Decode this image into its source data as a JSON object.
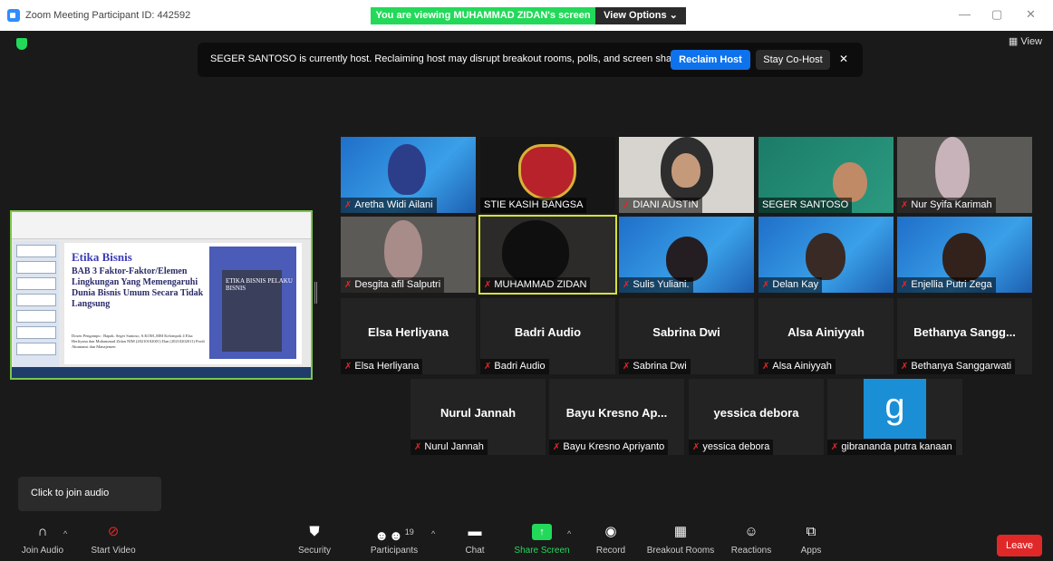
{
  "window": {
    "title": "Zoom Meeting Participant ID: 442592",
    "viewing_banner": "You are viewing MUHAMMAD ZIDAN's screen",
    "view_options": "View Options ⌄",
    "minimize": "—",
    "restore": "▢",
    "close": "✕"
  },
  "top": {
    "view_label": "▦ View"
  },
  "host_notice": {
    "message": "SEGER SANTOSO is currently host. Reclaiming host may disrupt breakout rooms, polls, and screen share",
    "reclaim_label": "Reclaim Host",
    "cohost_label": "Stay Co-Host",
    "close": "✕"
  },
  "shared_screen": {
    "slide_title": "Etika Bisnis",
    "slide_subtitle": "BAB 3 Faktor-Faktor/Elemen Lingkungan Yang Memengaruhi Dunia Bisnis Umum Secara Tidak Langsung",
    "slide_footer": "Dosen Pengampu : Bapak. Seger Santoso, S.KOM.,MM Kelompok 4 Elsa Herliyana dan Muhammad Zidan NIM (20210102001) Dan (20210202011) Prodi Akuntansi dan Manajemen",
    "book_title": "ETIKA BISNIS PELAKU BISNIS"
  },
  "participants": [
    {
      "name": "Aretha Widi Ailani",
      "big_name": "",
      "bg": "bg-blue"
    },
    {
      "name": "STIE KASIH BANGSA",
      "big_name": "",
      "bg": "bg-dark"
    },
    {
      "name": "DIANI AUSTIN",
      "big_name": "",
      "bg": "bg-wall"
    },
    {
      "name": "SEGER SANTOSO",
      "big_name": "",
      "bg": "bg-teal"
    },
    {
      "name": "Nur Syifa Karimah",
      "big_name": "",
      "bg": "bg-room"
    },
    {
      "name": "Desgita afil Salputri",
      "big_name": "",
      "bg": "bg-room"
    },
    {
      "name": "MUHAMMAD ZIDAN",
      "big_name": "",
      "bg": "bg-shadow"
    },
    {
      "name": "Sulis Yuliani.",
      "big_name": "",
      "bg": "bg-blue"
    },
    {
      "name": "Delan Kay",
      "big_name": "",
      "bg": "bg-blue"
    },
    {
      "name": "Enjellia Putri Zega",
      "big_name": "",
      "bg": "bg-blue"
    },
    {
      "name": "Elsa Herliyana",
      "big_name": "Elsa Herliyana",
      "bg": ""
    },
    {
      "name": "Badri Audio",
      "big_name": "Badri Audio",
      "bg": ""
    },
    {
      "name": "Sabrina Dwi",
      "big_name": "Sabrina Dwi",
      "bg": ""
    },
    {
      "name": "Alsa Ainiyyah",
      "big_name": "Alsa Ainiyyah",
      "bg": ""
    },
    {
      "name": "Bethanya Sanggarwati",
      "big_name": "Bethanya  Sangg...",
      "bg": ""
    },
    {
      "name": "Nurul Jannah",
      "big_name": "Nurul Jannah",
      "bg": ""
    },
    {
      "name": "Bayu Kresno Apriyanto",
      "big_name": "Bayu Kresno Ap...",
      "bg": ""
    },
    {
      "name": "yessica debora",
      "big_name": "yessica debora",
      "bg": ""
    },
    {
      "name": "gibrananda putra kanaan",
      "big_name": "",
      "bg": "",
      "avatar_letter": "g"
    }
  ],
  "tooltip": "Click to join audio",
  "toolbar": {
    "join_audio": "Join Audio",
    "start_video": "Start Video",
    "security": "Security",
    "participants": "Participants",
    "participant_count": "19",
    "chat": "Chat",
    "share_screen": "Share Screen",
    "record": "Record",
    "breakout_rooms": "Breakout Rooms",
    "reactions": "Reactions",
    "apps": "Apps",
    "leave": "Leave"
  },
  "colors": {
    "accent_green": "#23d959",
    "accent_blue": "#0e72ed",
    "leave_red": "#e02828",
    "active_speaker": "#d5e33a",
    "muted_mic": "#e02828"
  }
}
